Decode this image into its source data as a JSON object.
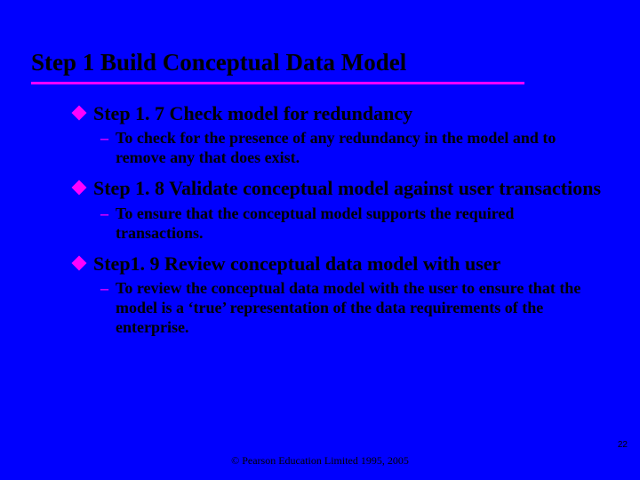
{
  "title": "Step 1 Build Conceptual Data Model",
  "items": [
    {
      "heading": "Step 1. 7  Check model for redundancy",
      "sub": "To check for the presence of any redundancy in the model and to remove any that does exist."
    },
    {
      "heading": "Step 1. 8  Validate conceptual model against user transactions",
      "sub": "To ensure that the conceptual model supports the required transactions."
    },
    {
      "heading": "Step1. 9   Review conceptual data model with user",
      "sub": "To review the conceptual data model with the user to ensure that the model is a ‘true’ representation of the data requirements of the enterprise."
    }
  ],
  "footer": "© Pearson Education Limited 1995, 2005",
  "page_number": "22",
  "dash": "–"
}
